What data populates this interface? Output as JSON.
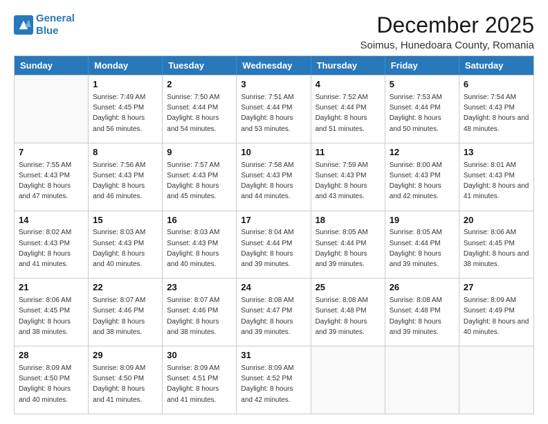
{
  "header": {
    "logo_line1": "General",
    "logo_line2": "Blue",
    "month": "December 2025",
    "location": "Soimus, Hunedoara County, Romania"
  },
  "days_of_week": [
    "Sunday",
    "Monday",
    "Tuesday",
    "Wednesday",
    "Thursday",
    "Friday",
    "Saturday"
  ],
  "weeks": [
    [
      {
        "day": "",
        "empty": true
      },
      {
        "day": "1",
        "sunrise": "7:49 AM",
        "sunset": "4:45 PM",
        "daylight": "8 hours and 56 minutes."
      },
      {
        "day": "2",
        "sunrise": "7:50 AM",
        "sunset": "4:44 PM",
        "daylight": "8 hours and 54 minutes."
      },
      {
        "day": "3",
        "sunrise": "7:51 AM",
        "sunset": "4:44 PM",
        "daylight": "8 hours and 53 minutes."
      },
      {
        "day": "4",
        "sunrise": "7:52 AM",
        "sunset": "4:44 PM",
        "daylight": "8 hours and 51 minutes."
      },
      {
        "day": "5",
        "sunrise": "7:53 AM",
        "sunset": "4:44 PM",
        "daylight": "8 hours and 50 minutes."
      },
      {
        "day": "6",
        "sunrise": "7:54 AM",
        "sunset": "4:43 PM",
        "daylight": "8 hours and 48 minutes."
      }
    ],
    [
      {
        "day": "7",
        "sunrise": "7:55 AM",
        "sunset": "4:43 PM",
        "daylight": "8 hours and 47 minutes."
      },
      {
        "day": "8",
        "sunrise": "7:56 AM",
        "sunset": "4:43 PM",
        "daylight": "8 hours and 46 minutes."
      },
      {
        "day": "9",
        "sunrise": "7:57 AM",
        "sunset": "4:43 PM",
        "daylight": "8 hours and 45 minutes."
      },
      {
        "day": "10",
        "sunrise": "7:58 AM",
        "sunset": "4:43 PM",
        "daylight": "8 hours and 44 minutes."
      },
      {
        "day": "11",
        "sunrise": "7:59 AM",
        "sunset": "4:43 PM",
        "daylight": "8 hours and 43 minutes."
      },
      {
        "day": "12",
        "sunrise": "8:00 AM",
        "sunset": "4:43 PM",
        "daylight": "8 hours and 42 minutes."
      },
      {
        "day": "13",
        "sunrise": "8:01 AM",
        "sunset": "4:43 PM",
        "daylight": "8 hours and 41 minutes."
      }
    ],
    [
      {
        "day": "14",
        "sunrise": "8:02 AM",
        "sunset": "4:43 PM",
        "daylight": "8 hours and 41 minutes."
      },
      {
        "day": "15",
        "sunrise": "8:03 AM",
        "sunset": "4:43 PM",
        "daylight": "8 hours and 40 minutes."
      },
      {
        "day": "16",
        "sunrise": "8:03 AM",
        "sunset": "4:43 PM",
        "daylight": "8 hours and 40 minutes."
      },
      {
        "day": "17",
        "sunrise": "8:04 AM",
        "sunset": "4:44 PM",
        "daylight": "8 hours and 39 minutes."
      },
      {
        "day": "18",
        "sunrise": "8:05 AM",
        "sunset": "4:44 PM",
        "daylight": "8 hours and 39 minutes."
      },
      {
        "day": "19",
        "sunrise": "8:05 AM",
        "sunset": "4:44 PM",
        "daylight": "8 hours and 39 minutes."
      },
      {
        "day": "20",
        "sunrise": "8:06 AM",
        "sunset": "4:45 PM",
        "daylight": "8 hours and 38 minutes."
      }
    ],
    [
      {
        "day": "21",
        "sunrise": "8:06 AM",
        "sunset": "4:45 PM",
        "daylight": "8 hours and 38 minutes."
      },
      {
        "day": "22",
        "sunrise": "8:07 AM",
        "sunset": "4:46 PM",
        "daylight": "8 hours and 38 minutes."
      },
      {
        "day": "23",
        "sunrise": "8:07 AM",
        "sunset": "4:46 PM",
        "daylight": "8 hours and 38 minutes."
      },
      {
        "day": "24",
        "sunrise": "8:08 AM",
        "sunset": "4:47 PM",
        "daylight": "8 hours and 39 minutes."
      },
      {
        "day": "25",
        "sunrise": "8:08 AM",
        "sunset": "4:48 PM",
        "daylight": "8 hours and 39 minutes."
      },
      {
        "day": "26",
        "sunrise": "8:08 AM",
        "sunset": "4:48 PM",
        "daylight": "8 hours and 39 minutes."
      },
      {
        "day": "27",
        "sunrise": "8:09 AM",
        "sunset": "4:49 PM",
        "daylight": "8 hours and 40 minutes."
      }
    ],
    [
      {
        "day": "28",
        "sunrise": "8:09 AM",
        "sunset": "4:50 PM",
        "daylight": "8 hours and 40 minutes."
      },
      {
        "day": "29",
        "sunrise": "8:09 AM",
        "sunset": "4:50 PM",
        "daylight": "8 hours and 41 minutes."
      },
      {
        "day": "30",
        "sunrise": "8:09 AM",
        "sunset": "4:51 PM",
        "daylight": "8 hours and 41 minutes."
      },
      {
        "day": "31",
        "sunrise": "8:09 AM",
        "sunset": "4:52 PM",
        "daylight": "8 hours and 42 minutes."
      },
      {
        "day": "",
        "empty": true
      },
      {
        "day": "",
        "empty": true
      },
      {
        "day": "",
        "empty": true
      }
    ]
  ]
}
